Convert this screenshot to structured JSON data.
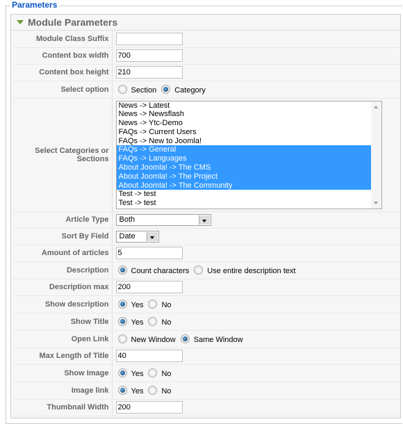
{
  "fieldset_legend": "Parameters",
  "panel_title": "Module Parameters",
  "fields": {
    "module_class_suffix": {
      "label": "Module Class Suffix",
      "value": ""
    },
    "content_box_width": {
      "label": "Content box width",
      "value": "700"
    },
    "content_box_height": {
      "label": "Content box height",
      "value": "210"
    },
    "select_option": {
      "label": "Select option",
      "options": [
        "Section",
        "Category"
      ],
      "selected": "Category"
    },
    "select_categories": {
      "label": "Select Categories or Sections",
      "options": [
        {
          "text": "News -> Latest",
          "selected": false
        },
        {
          "text": "News -> Newsflash",
          "selected": false
        },
        {
          "text": "News -> Ytc-Demo",
          "selected": false
        },
        {
          "text": "FAQs -> Current Users",
          "selected": false
        },
        {
          "text": "FAQs -> New to Joomla!",
          "selected": false
        },
        {
          "text": "FAQs -> General",
          "selected": true
        },
        {
          "text": "FAQs -> Languages",
          "selected": true
        },
        {
          "text": "About Joomla! -> The CMS",
          "selected": true
        },
        {
          "text": "About Joomla! -> The Project",
          "selected": true
        },
        {
          "text": "About Joomla! -> The Community",
          "selected": true
        },
        {
          "text": "Test -> test",
          "selected": false
        },
        {
          "text": "Test -> test",
          "selected": false
        }
      ]
    },
    "article_type": {
      "label": "Article Type",
      "value": "Both"
    },
    "sort_by_field": {
      "label": "Sort By Field",
      "value": "Date"
    },
    "amount_of_articles": {
      "label": "Amount of articles",
      "value": "5"
    },
    "description": {
      "label": "Description",
      "options": [
        "Count characters",
        "Use entire description text"
      ],
      "selected": "Count characters"
    },
    "description_max": {
      "label": "Description max",
      "value": "200"
    },
    "show_description": {
      "label": "Show description",
      "options": [
        "Yes",
        "No"
      ],
      "selected": "Yes"
    },
    "show_title": {
      "label": "Show Title",
      "options": [
        "Yes",
        "No"
      ],
      "selected": "Yes"
    },
    "open_link": {
      "label": "Open Link",
      "options": [
        "New Window",
        "Same Window"
      ],
      "selected": "Same Window"
    },
    "max_length_title": {
      "label": "Max Length of Title",
      "value": "40"
    },
    "show_image": {
      "label": "Show Image",
      "options": [
        "Yes",
        "No"
      ],
      "selected": "Yes"
    },
    "image_link": {
      "label": "Image link",
      "options": [
        "Yes",
        "No"
      ],
      "selected": "Yes"
    },
    "thumbnail_width": {
      "label": "Thumbnail Width",
      "value": "200"
    }
  },
  "colors": {
    "legend": "#0b55c4",
    "selection": "#3399ff",
    "label": "#666666"
  }
}
